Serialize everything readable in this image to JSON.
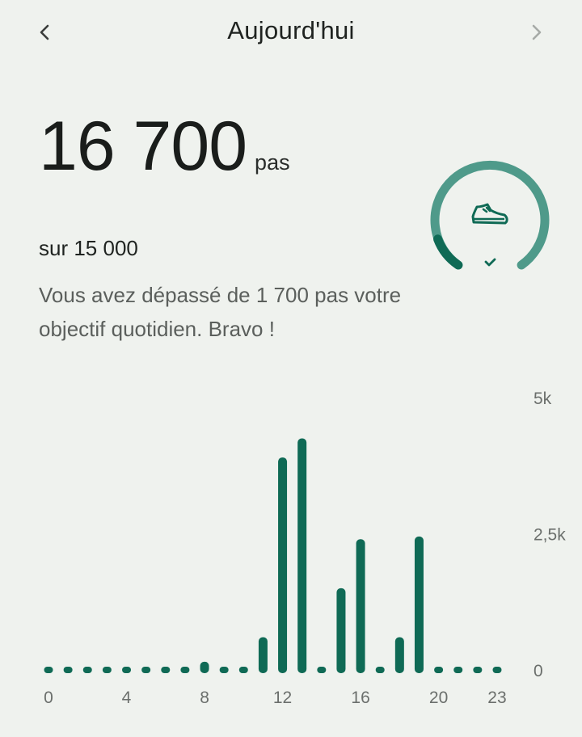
{
  "header": {
    "title": "Aujourd'hui",
    "prev_icon": "chevron-left-icon",
    "next_icon": "chevron-right-icon"
  },
  "summary": {
    "steps": "16 700",
    "unit": "pas",
    "goal": "sur 15 000",
    "message": "Vous avez dépassé de 1 700 pas votre objectif quotidien. Bravo !"
  },
  "ring": {
    "icon": "sneaker-icon",
    "check_icon": "check-icon",
    "progress_fraction": 1.11,
    "track_color": "#4f9a8a",
    "overflow_color": "#0f6a55"
  },
  "colors": {
    "accent": "#0f6a55"
  },
  "chart_data": {
    "type": "bar",
    "x": [
      0,
      1,
      2,
      3,
      4,
      5,
      6,
      7,
      8,
      9,
      10,
      11,
      12,
      13,
      14,
      15,
      16,
      17,
      18,
      19,
      20,
      21,
      22,
      23
    ],
    "values": [
      0,
      0,
      0,
      0,
      0,
      0,
      0,
      0,
      150,
      60,
      0,
      600,
      3900,
      4250,
      80,
      1500,
      2400,
      0,
      600,
      2450,
      0,
      0,
      0,
      0
    ],
    "xticks": [
      "0",
      "4",
      "8",
      "12",
      "16",
      "20",
      "23"
    ],
    "xtick_values": [
      0,
      4,
      8,
      12,
      16,
      20,
      23
    ],
    "yticks": [
      "0",
      "2,5k",
      "5k"
    ],
    "ytick_values": [
      0,
      2500,
      5000
    ],
    "ylim": [
      0,
      5000
    ],
    "grid": false
  }
}
